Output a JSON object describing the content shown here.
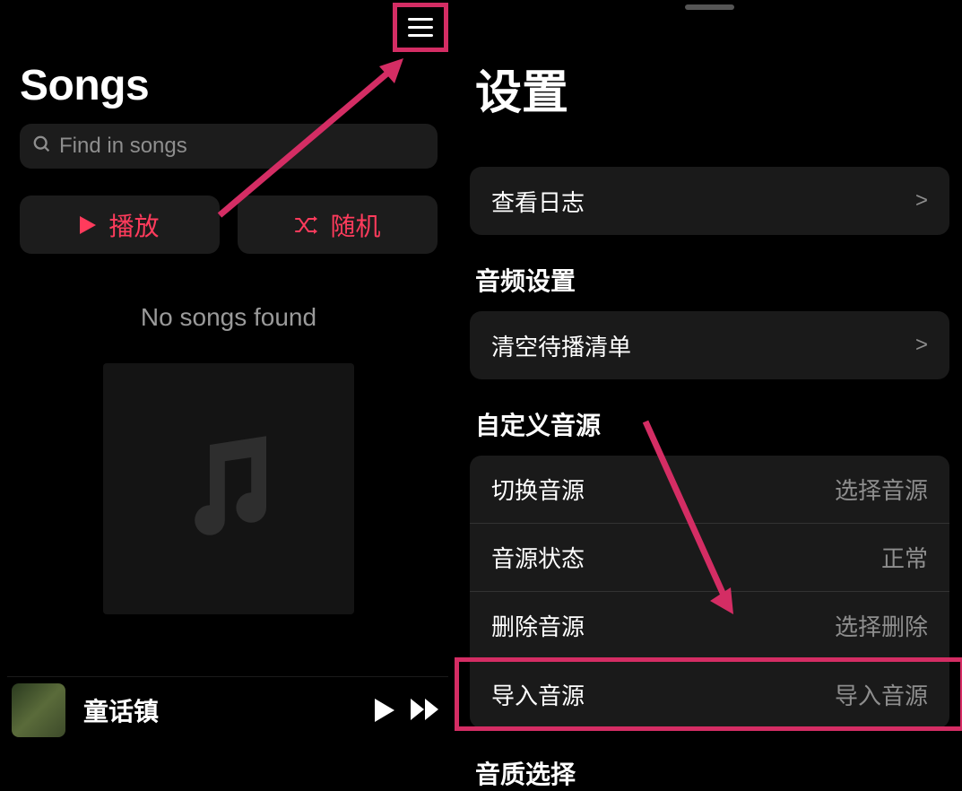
{
  "left": {
    "title": "Songs",
    "search_placeholder": "Find in songs",
    "play_label": "播放",
    "shuffle_label": "随机",
    "empty_message": "No songs found",
    "now_playing": {
      "title": "童话镇"
    }
  },
  "right": {
    "title": "设置",
    "item_view_logs": "查看日志",
    "section_audio": "音频设置",
    "item_clear_queue": "清空待播清单",
    "section_custom_source": "自定义音源",
    "source_items": [
      {
        "label": "切换音源",
        "value": "选择音源"
      },
      {
        "label": "音源状态",
        "value": "正常"
      },
      {
        "label": "删除音源",
        "value": "选择删除"
      },
      {
        "label": "导入音源",
        "value": "导入音源"
      }
    ],
    "section_quality": "音质选择",
    "chevron": ">"
  }
}
